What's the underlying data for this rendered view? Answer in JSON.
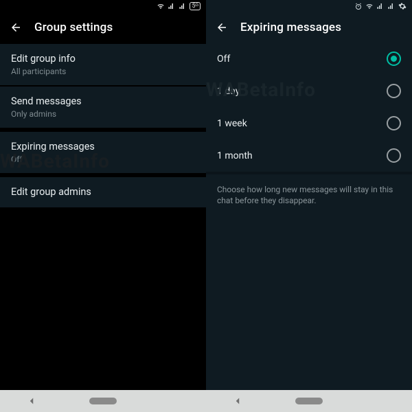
{
  "watermark": "WABetaInfo",
  "left": {
    "title": "Group settings",
    "items": [
      {
        "primary": "Edit group info",
        "secondary": "All participants"
      },
      {
        "primary": "Send messages",
        "secondary": "Only admins"
      },
      {
        "primary": "Expiring messages",
        "secondary": "Off"
      },
      {
        "primary": "Edit group admins",
        "secondary": ""
      }
    ],
    "status_5g": "5ᴳ"
  },
  "right": {
    "title": "Expiring messages",
    "options": [
      {
        "label": "Off",
        "selected": true
      },
      {
        "label": "1 day",
        "selected": false
      },
      {
        "label": "1 week",
        "selected": false
      },
      {
        "label": "1 month",
        "selected": false
      }
    ],
    "footer": "Choose how long new messages will stay in this chat before they disappear."
  }
}
